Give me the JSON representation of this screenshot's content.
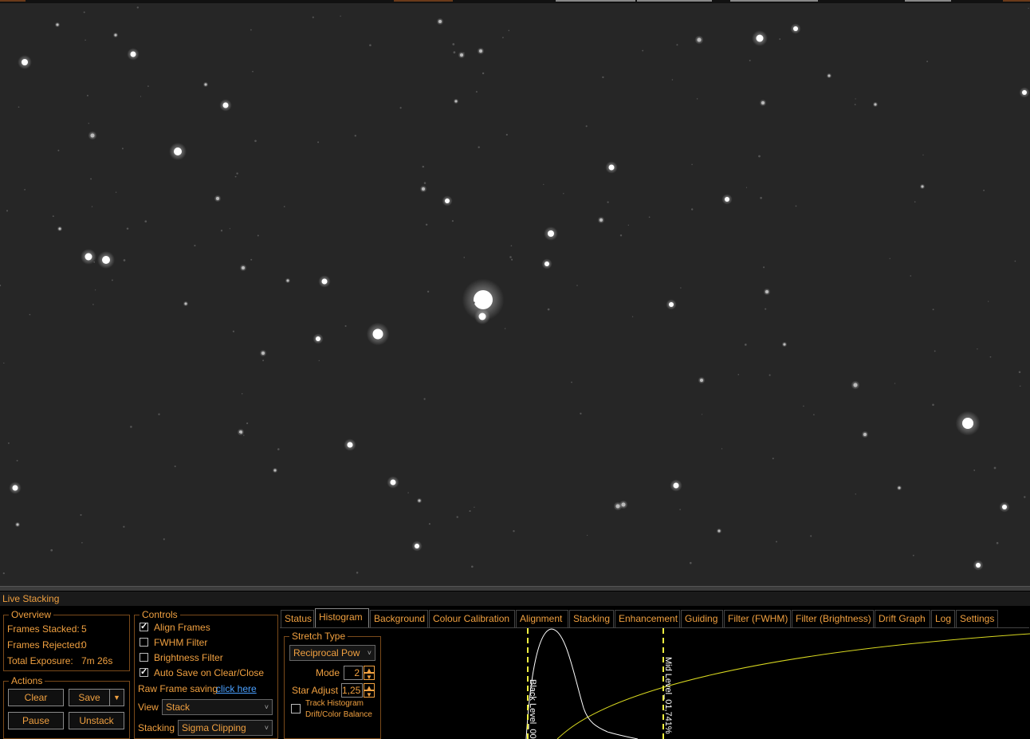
{
  "panel": {
    "title": "Live Stacking"
  },
  "overview": {
    "legend": "Overview",
    "frames_stacked_label": "Frames Stacked:",
    "frames_stacked_value": "5",
    "frames_rejected_label": "Frames Rejected:",
    "frames_rejected_value": "0",
    "total_exposure_label": "Total Exposure:",
    "total_exposure_value": "7m 26s"
  },
  "actions": {
    "legend": "Actions",
    "clear": "Clear",
    "save": "Save",
    "pause": "Pause",
    "unstack": "Unstack"
  },
  "controls": {
    "legend": "Controls",
    "align_frames": {
      "label": "Align Frames",
      "checked": true
    },
    "fwhm_filter": {
      "label": "FWHM Filter",
      "checked": false
    },
    "brightness_filter": {
      "label": "Brightness Filter",
      "checked": false
    },
    "auto_save": {
      "label": "Auto Save on Clear/Close",
      "checked": true
    },
    "raw_frame_label": "Raw Frame saving",
    "raw_frame_link": "click here",
    "view_label": "View",
    "view_value": "Stack",
    "stacking_label": "Stacking",
    "stacking_value": "Sigma Clipping"
  },
  "tabs": [
    "Status",
    "Histogram",
    "Background",
    "Colour Calibration",
    "Alignment",
    "Stacking",
    "Enhancement",
    "Guiding",
    "Filter (FWHM)",
    "Filter (Brightness)",
    "Drift Graph",
    "Log",
    "Settings"
  ],
  "active_tab": "Histogram",
  "stretch": {
    "legend": "Stretch Type",
    "type_value": "Reciprocal Pow",
    "mode_label": "Mode",
    "mode_value": "2",
    "star_adjust_label": "Star Adjust",
    "star_adjust_value": "1,25",
    "track_label_1": "Track Histogram",
    "track_label_2": "Drift/Color Balance",
    "track_checked": false
  },
  "histogram": {
    "black_level_label": "Black Level_00",
    "mid_level_label": "Mid Level_01,741%"
  },
  "colors": {
    "accent": "#f0a040",
    "link": "#4aa0ff",
    "marker": "#f0f040"
  }
}
